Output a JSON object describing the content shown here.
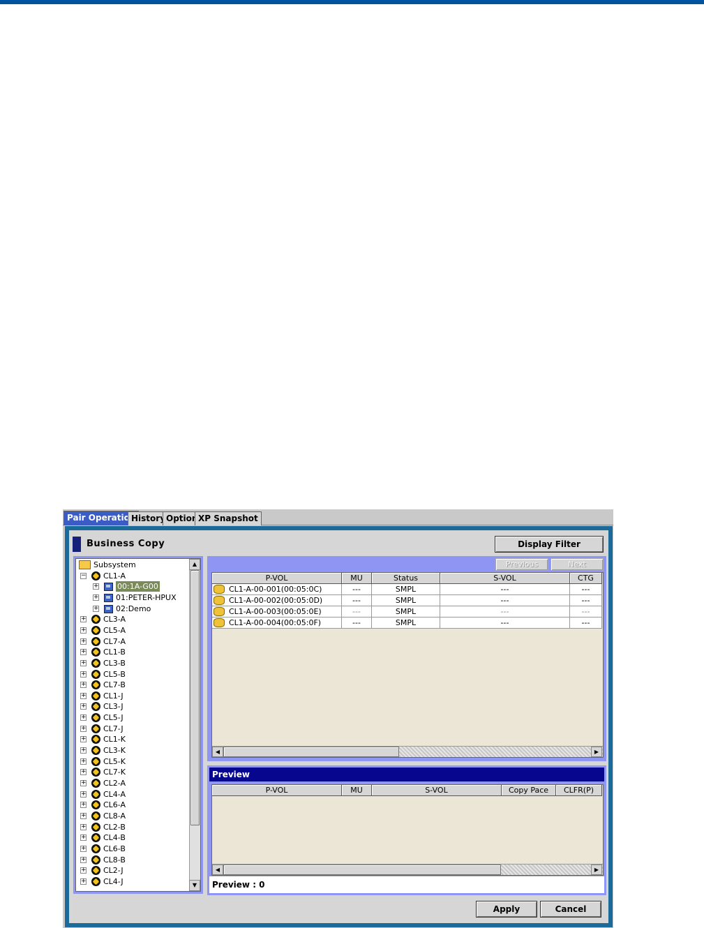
{
  "tabs": [
    {
      "label": "Pair Operation",
      "active": true
    },
    {
      "label": "History",
      "active": false
    },
    {
      "label": "Option",
      "active": false
    },
    {
      "label": "XP Snapshot",
      "active": false
    }
  ],
  "header": {
    "title": "Business Copy",
    "display_filter_label": "Display Filter"
  },
  "tree": {
    "root": "Subsystem",
    "expanded_port": "CL1-A",
    "groups": [
      {
        "label": "00:1A-G00",
        "selected": true
      },
      {
        "label": "01:PETER-HPUX",
        "selected": false
      },
      {
        "label": "02:Demo",
        "selected": false
      }
    ],
    "ports": [
      "CL3-A",
      "CL5-A",
      "CL7-A",
      "CL1-B",
      "CL3-B",
      "CL5-B",
      "CL7-B",
      "CL1-J",
      "CL3-J",
      "CL5-J",
      "CL7-J",
      "CL1-K",
      "CL3-K",
      "CL5-K",
      "CL7-K",
      "CL2-A",
      "CL4-A",
      "CL6-A",
      "CL8-A",
      "CL2-B",
      "CL4-B",
      "CL6-B",
      "CL8-B",
      "CL2-J",
      "CL4-J"
    ]
  },
  "pair_table": {
    "previous_label": "Previous",
    "next_label": "Next",
    "columns": [
      "P-VOL",
      "MU",
      "Status",
      "S-VOL",
      "CTG"
    ],
    "rows": [
      {
        "pvol": "CL1-A-00-001(00:05:0C)",
        "mu": "---",
        "status": "SMPL",
        "svol": "---",
        "ctg": "---",
        "grey": false
      },
      {
        "pvol": "CL1-A-00-002(00:05:0D)",
        "mu": "---",
        "status": "SMPL",
        "svol": "---",
        "ctg": "---",
        "grey": false
      },
      {
        "pvol": "CL1-A-00-003(00:05:0E)",
        "mu": "---",
        "status": "SMPL",
        "svol": "---",
        "ctg": "---",
        "grey": true
      },
      {
        "pvol": "CL1-A-00-004(00:05:0F)",
        "mu": "---",
        "status": "SMPL",
        "svol": "---",
        "ctg": "---",
        "grey": false
      }
    ]
  },
  "preview": {
    "title": "Preview",
    "columns": [
      "P-VOL",
      "MU",
      "S-VOL",
      "Copy Pace",
      "CLFR(P)"
    ],
    "count_label": "Preview : 0"
  },
  "footer": {
    "apply_label": "Apply",
    "cancel_label": "Cancel"
  }
}
